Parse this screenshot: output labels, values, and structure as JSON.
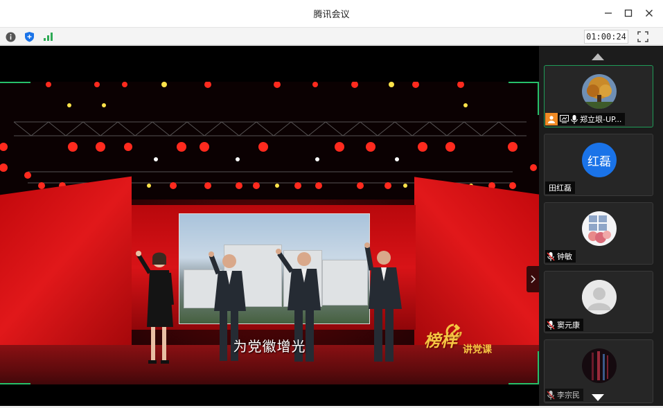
{
  "window": {
    "title": "腾讯会议"
  },
  "toolbar": {
    "timer": "01:00:24",
    "icons": [
      "info-icon",
      "shield-icon",
      "signal-icon",
      "fullscreen-icon"
    ]
  },
  "video": {
    "caption": "为党徽增光",
    "logo_big": "榜样",
    "logo_small": "讲党课"
  },
  "participants": [
    {
      "name": "郑立垠-UP...",
      "avatar_type": "photo-tree",
      "active": true,
      "status_icons": [
        "host-icon",
        "screen-share-icon",
        "mic-icon"
      ]
    },
    {
      "name": "田红磊",
      "avatar_type": "text",
      "avatar_text": "红磊",
      "avatar_color": "#1a73e8",
      "active": false,
      "status_icons": []
    },
    {
      "name": "钟敏",
      "avatar_type": "photo-flowers",
      "active": false,
      "status_icons": [
        "mic-muted-icon"
      ]
    },
    {
      "name": "窦元康",
      "avatar_type": "default",
      "active": false,
      "status_icons": [
        "mic-muted-icon"
      ]
    },
    {
      "name": "李宗民",
      "avatar_type": "photo-dark",
      "active": false,
      "status_icons": [
        "mic-muted-icon"
      ]
    }
  ],
  "colors": {
    "accent_green": "#1f9c58",
    "panel_bg": "#1c1c1c",
    "stage_red": "#d81317"
  }
}
